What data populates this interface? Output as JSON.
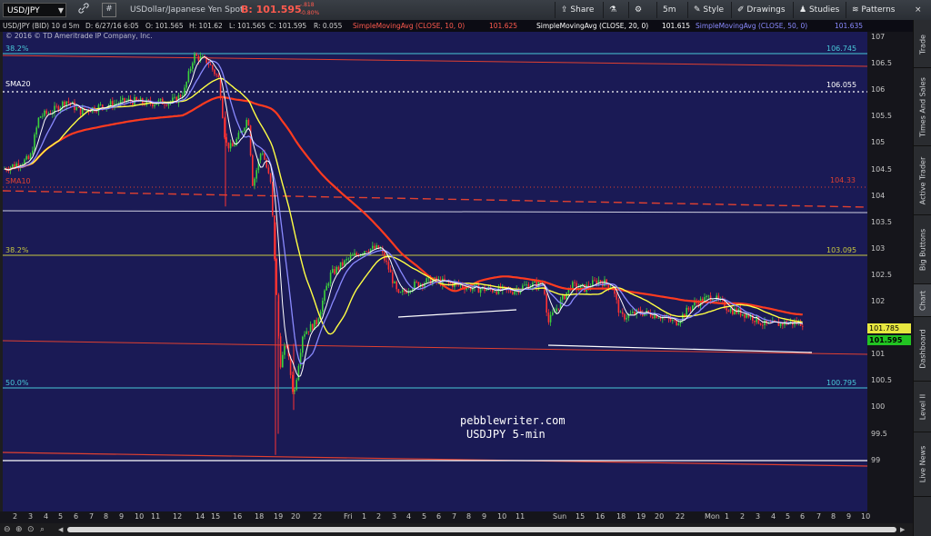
{
  "toolbar": {
    "symbol": "USD/JPY",
    "description": "USDollar/Japanese Yen Spot",
    "bid_label": "B: 101.595",
    "change": "-.818",
    "change_pct": "-0.80%",
    "share": "Share",
    "timeframe": "5m",
    "style": "Style",
    "drawings": "Drawings",
    "studies": "Studies",
    "patterns": "Patterns",
    "icons": [
      "link-icon",
      "hash-icon",
      "share-icon",
      "flask-icon",
      "gear-icon",
      "style-icon",
      "drawings-icon",
      "studies-icon",
      "patterns-icon"
    ]
  },
  "study_bar": {
    "symbol_info": "USD/JPY (BID) 10 d 5m",
    "date": "D: 6/27/16 6:05",
    "open": "O: 101.565",
    "high": "H: 101.62",
    "low": "L: 101.565",
    "close": "C: 101.595",
    "range": "R: 0.055",
    "sma10_label": "SimpleMovingAvg (CLOSE, 10, 0)",
    "sma10_value": "101.625",
    "sma20_label": "SimpleMovingAvg (CLOSE, 20, 0)",
    "sma20_value": "101.615",
    "sma50_label": "SimpleMovingAvg (CLOSE, 50, 0)",
    "sma50_value": "101.635"
  },
  "copyright": "© 2016 © TD Ameritrade IP Company, Inc.",
  "levels": {
    "fib382_top": "38.2%",
    "fib382_top_price": "106.745",
    "sma20_label": "SMA20",
    "sma20_price": "106.055",
    "sma10_label": "SMA10",
    "sma10_price": "104.33",
    "fib382_mid": "38.2%",
    "fib382_mid_price": "103.095",
    "fib50": "50.0%",
    "fib50_price": "100.795",
    "current_upper": "101.785",
    "current_price": "101.595"
  },
  "watermark": {
    "line1": "pebblewriter.com",
    "line2": "USDJPY 5-min"
  },
  "price_axis": [
    "107",
    "106.5",
    "106",
    "105.5",
    "105",
    "104.5",
    "104",
    "103.5",
    "103",
    "102.5",
    "102",
    "101.5",
    "101",
    "100.5",
    "100",
    "99.5",
    "99"
  ],
  "time_axis": [
    "2",
    "3",
    "4",
    "5",
    "6",
    "7",
    "8",
    "9",
    "10",
    "11",
    "12",
    "14",
    "15",
    "16",
    "18",
    "19",
    "20",
    "22",
    "Fri",
    "1",
    "2",
    "3",
    "4",
    "5",
    "6",
    "7",
    "8",
    "9",
    "10",
    "11",
    "Sun",
    "15",
    "16",
    "18",
    "19",
    "20",
    "22",
    "Mon",
    "1",
    "2",
    "3",
    "4",
    "5",
    "6",
    "7",
    "8",
    "9",
    "10"
  ],
  "right_rail": [
    "Trade",
    "Times And Sales",
    "Active Trader",
    "Big Buttons",
    "Chart",
    "Dashboard",
    "Level II",
    "Live News"
  ],
  "colors": {
    "plot_bg": "#1a1a55",
    "sma10": "#ffffff",
    "sma20": "#8a8aff",
    "sma50": "#ffff44",
    "sma200": "#ff3b1f",
    "fib_cyan": "#48c8d8",
    "up_candle": "#3cd23c",
    "down_candle": "#ff3232"
  }
}
